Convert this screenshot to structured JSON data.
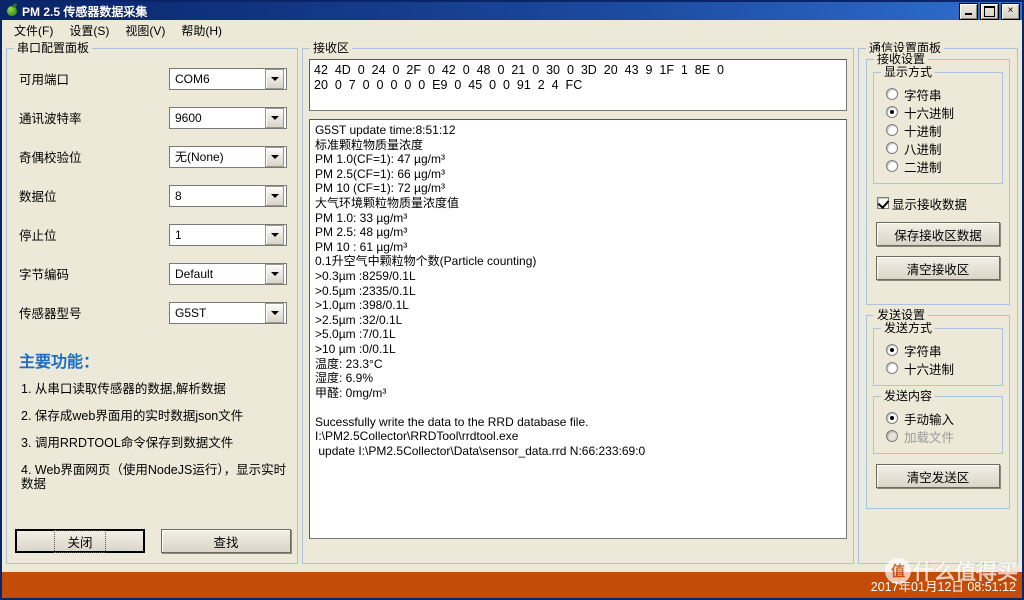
{
  "window": {
    "title": "PM 2.5 传感器数据采集",
    "icon": "apple-icon",
    "buttons": {
      "minimize": "minimize-icon",
      "maximize": "maximize-icon",
      "close": "×"
    }
  },
  "menu": [
    {
      "label": "文件(F)",
      "name": "menu-file"
    },
    {
      "label": "设置(S)",
      "name": "menu-settings"
    },
    {
      "label": "视图(V)",
      "name": "menu-view"
    },
    {
      "label": "帮助(H)",
      "name": "menu-help"
    }
  ],
  "left_panel": {
    "legend": "串口配置面板",
    "rows": [
      {
        "label": "可用端口",
        "value": "COM6"
      },
      {
        "label": "通讯波特率",
        "value": "9600"
      },
      {
        "label": "奇偶校验位",
        "value": "无(None)"
      },
      {
        "label": "数据位",
        "value": "8"
      },
      {
        "label": "停止位",
        "value": "1"
      },
      {
        "label": "字节编码",
        "value": "Default"
      },
      {
        "label": "传感器型号",
        "value": "G5ST"
      }
    ],
    "features_title": "主要功能：",
    "features": [
      "1. 从串口读取传感器的数据,解析数据",
      "2. 保存成web界面用的实时数据json文件",
      "3. 调用RRDTOOL命令保存到数据文件",
      "4. Web界面网页（使用NodeJS运行），显示实时数据"
    ],
    "close_button": "关闭",
    "find_button": "查找"
  },
  "receive_panel": {
    "legend": "接收区",
    "hex_data": "42  4D  0  24  0  2F  0  42  0  48  0  21  0  30  0  3D  20  43  9  1F  1  8E  0\n20  0  7  0  0  0  0  0  E9  0  45  0  0  91  2  4  FC",
    "log": "G5ST update time:8:51:12\n标准颗粒物质量浓度\nPM 1.0(CF=1): 47 µg/m³\nPM 2.5(CF=1): 66 µg/m³\nPM 10 (CF=1): 72 µg/m³\n大气环境颗粒物质量浓度值\nPM 1.0: 33 µg/m³\nPM 2.5: 48 µg/m³\nPM 10 : 61 µg/m³\n0.1升空气中颗粒物个数(Particle counting)\n>0.3µm :8259/0.1L\n>0.5µm :2335/0.1L\n>1.0µm :398/0.1L\n>2.5µm :32/0.1L\n>5.0µm :7/0.1L\n>10 µm :0/0.1L\n温度: 23.3°C\n湿度: 6.9%\n甲醛: 0mg/m³\n\nSucessfully write the data to the RRD database file.\nI:\\PM2.5Collector\\RRDTool\\rrdtool.exe\n update I:\\PM2.5Collector\\Data\\sensor_data.rrd N:66:233:69:0"
  },
  "comm_panel": {
    "legend": "通信设置面板",
    "receive_settings": {
      "legend": "接收设置",
      "display_mode": {
        "legend": "显示方式",
        "options": [
          {
            "label": "字符串",
            "selected": false
          },
          {
            "label": "十六进制",
            "selected": true
          },
          {
            "label": "十进制",
            "selected": false
          },
          {
            "label": "八进制",
            "selected": false
          },
          {
            "label": "二进制",
            "selected": false
          }
        ]
      },
      "show_received_label": "显示接收数据",
      "show_received_checked": true,
      "save_button": "保存接收区数据",
      "clear_button": "清空接收区"
    },
    "send_settings": {
      "legend": "发送设置",
      "send_mode": {
        "legend": "发送方式",
        "options": [
          {
            "label": "字符串",
            "selected": true
          },
          {
            "label": "十六进制",
            "selected": false
          }
        ]
      },
      "send_content": {
        "legend": "发送内容",
        "options": [
          {
            "label": "手动输入",
            "selected": true,
            "disabled": false
          },
          {
            "label": "加载文件",
            "selected": false,
            "disabled": true
          }
        ]
      },
      "clear_button": "清空发送区"
    }
  },
  "statusbar": {
    "timestamp": "2017年01月12日 08:51:12",
    "background": "#c24c08",
    "watermark_badge": "值",
    "watermark_text": "什么值得买"
  },
  "colors": {
    "titlebar": "#0a246a",
    "face": "#ece9d8",
    "group_border": "#a8c4e0",
    "accent_blue": "#1a6fc4",
    "status_orange": "#c24c08"
  }
}
